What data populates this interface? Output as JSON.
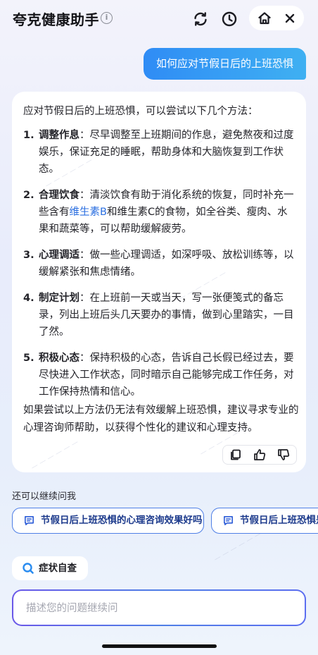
{
  "header": {
    "title": "夸克健康助手",
    "info_icon": "info-icon",
    "refresh_icon": "refresh-icon",
    "history_icon": "clock-icon",
    "home_icon": "home-icon",
    "close_icon": "close-icon"
  },
  "conversation": {
    "user_message": "如何应对节假日后的上班恐惧",
    "answer": {
      "intro": "应对节假日后的上班恐惧，可以尝试以下几个方法：",
      "items": [
        {
          "num": "1.",
          "title": "调整作息",
          "text": "：尽早调整至上班期间的作息，避免熬夜和过度娱乐，保证充足的睡眠，帮助身体和大脑恢复到工作状态。"
        },
        {
          "num": "2.",
          "title": "合理饮食",
          "text_before": "：清淡饮食有助于消化系统的恢复，同时补充一些含有",
          "link": "维生素B",
          "text_after": "和维生素C的食物，如全谷类、瘦肉、水果和蔬菜等，可以帮助缓解疲劳。"
        },
        {
          "num": "3.",
          "title": "心理调适",
          "text": "：做一些心理调适，如深呼吸、放松训练等，以缓解紧张和焦虑情绪。"
        },
        {
          "num": "4.",
          "title": "制定计划",
          "text": "：在上班前一天或当天，写一张便笺式的备忘录，列出上班后头几天要办的事情，做到心里踏实，一目了然。"
        },
        {
          "num": "5.",
          "title": "积极心态",
          "text": "：保持积极的心态，告诉自己长假已经过去，要尽快进入工作状态，同时暗示自己能够完成工作任务，对工作保持热情和信心。"
        }
      ],
      "outro": "如果尝试以上方法仍无法有效缓解上班恐惧，建议寻求专业的心理咨询师帮助，以获得个性化的建议和心理支持。",
      "actions": [
        "copy-icon",
        "thumbs-up-icon",
        "thumbs-down-icon"
      ]
    }
  },
  "suggestions": {
    "label": "还可以继续问我",
    "items": [
      "节假日后上班恐惧的心理咨询效果好吗",
      "节假日后上班恐惧是"
    ]
  },
  "symptom_button": "症状自查",
  "composer": {
    "placeholder": "描述您的问题继续问"
  },
  "colors": {
    "accent": "#2f8cf5",
    "link": "#2b6fe0",
    "chip_border": "#4f7fe6"
  }
}
